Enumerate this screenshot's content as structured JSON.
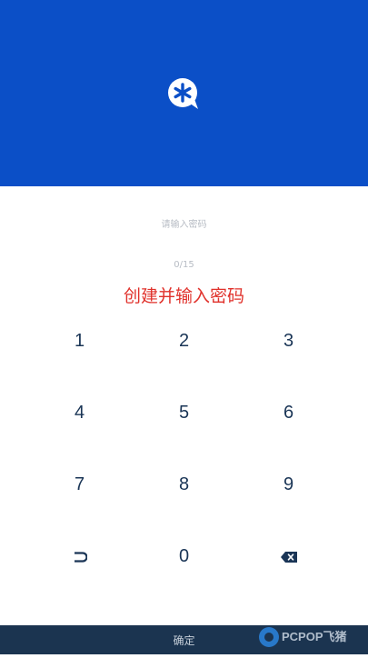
{
  "header": {
    "logo_icon": "asterisk-chat-bubble-icon",
    "bg_color": "#0b4fc7"
  },
  "input": {
    "placeholder": "请输入密码",
    "counter": "0/15"
  },
  "prompt": {
    "text": "创建并输入密码",
    "color": "#e0312b"
  },
  "keypad": {
    "keys": [
      "1",
      "2",
      "3",
      "4",
      "5",
      "6",
      "7",
      "8",
      "9",
      "0"
    ],
    "left_icon": "return-arrow-icon",
    "right_icon": "backspace-icon"
  },
  "footer": {
    "confirm_label": "确定",
    "bg_color": "#1b3450"
  },
  "watermark": {
    "text": "PCPOP飞猪"
  }
}
